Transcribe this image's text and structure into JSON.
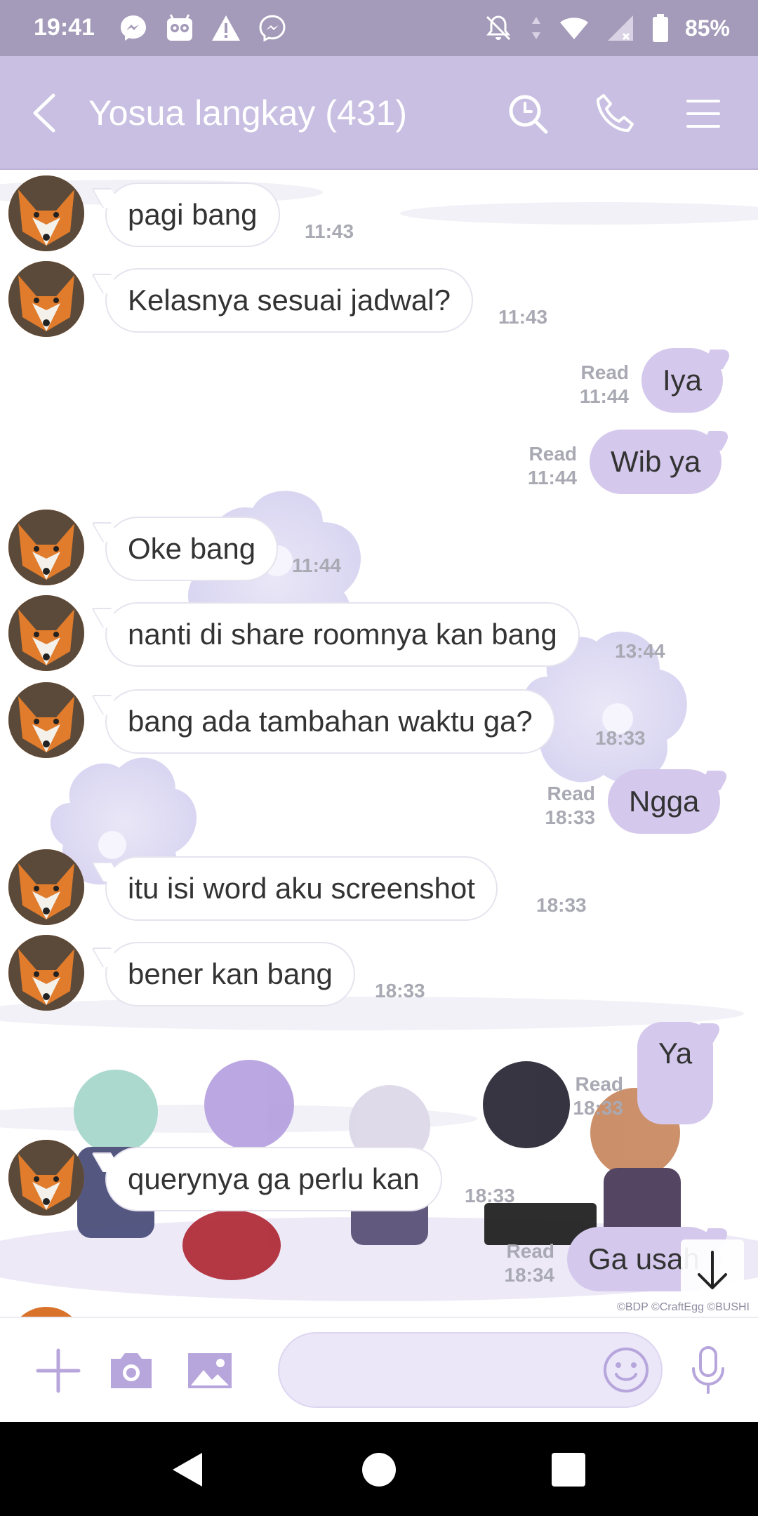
{
  "status_bar": {
    "time": "19:41",
    "battery": "85%"
  },
  "header": {
    "title": "Yosua langkay (431)"
  },
  "messages": [
    {
      "text": "pagi bang",
      "time": "11:43"
    },
    {
      "text": "Kelasnya sesuai jadwal?",
      "time": "11:43"
    },
    {
      "text": "Iya",
      "read": "Read",
      "time": "11:44"
    },
    {
      "text": "Wib ya",
      "read": "Read",
      "time": "11:44"
    },
    {
      "text": "Oke bang",
      "time": "11:44"
    },
    {
      "text": "nanti di share roomnya kan bang",
      "time": "13:44"
    },
    {
      "text": "bang ada tambahan waktu ga?",
      "time": "18:33"
    },
    {
      "text": "Ngga",
      "read": "Read",
      "time": "18:33"
    },
    {
      "text": "itu isi word aku screenshot",
      "time": "18:33"
    },
    {
      "text": "bener kan bang",
      "time": "18:33"
    },
    {
      "text": "Ya",
      "read": "Read",
      "time": "18:33"
    },
    {
      "text": "querynya ga perlu kan",
      "time": "18:33"
    },
    {
      "text": "Ga usah",
      "read": "Read",
      "time": "18:34"
    }
  ],
  "copyright": "©BDP ©CraftEgg ©BUSHI",
  "input": {
    "value": ""
  },
  "colors": {
    "status_bar": "#a49ab9",
    "header": "#c9bfe2",
    "bubble_out": "#d4c8ec",
    "accent": "#b7a6dc"
  }
}
